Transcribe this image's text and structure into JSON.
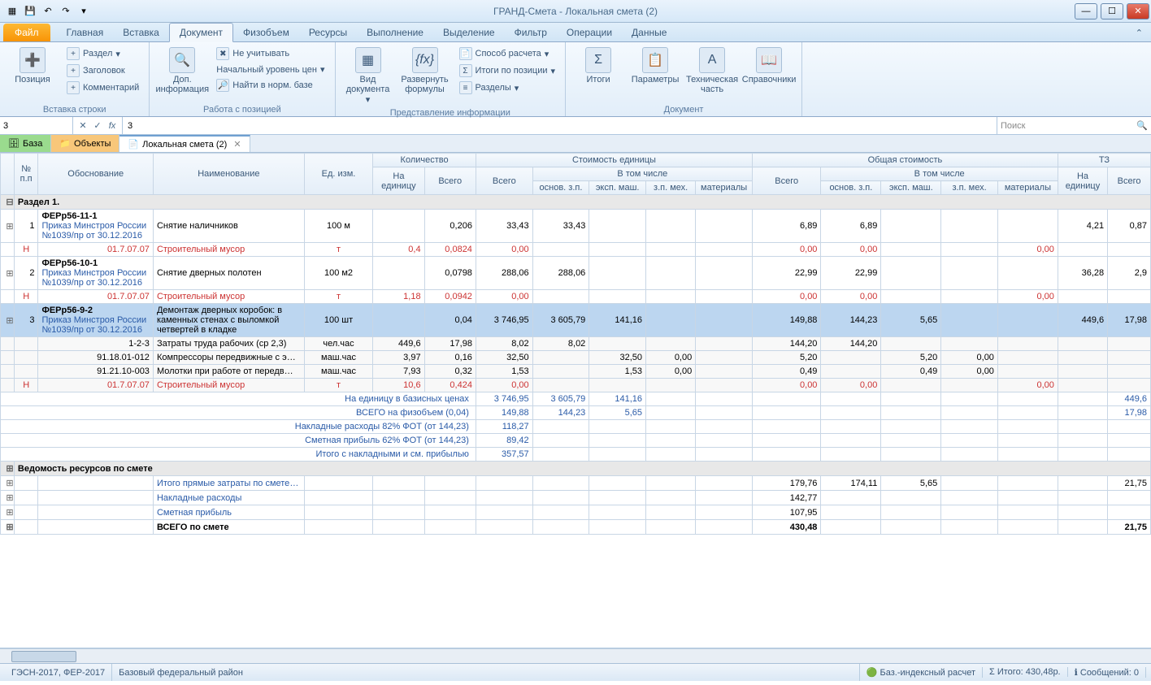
{
  "title": "ГРАНД-Смета - Локальная смета (2)",
  "ribbon_tabs": {
    "file": "Файл",
    "items": [
      "Главная",
      "Вставка",
      "Документ",
      "Физобъем",
      "Ресурсы",
      "Выполнение",
      "Выделение",
      "Фильтр",
      "Операции",
      "Данные"
    ],
    "active": 2
  },
  "ribbon": {
    "g1": {
      "label": "Вставка строки",
      "pos": "Позиция",
      "razdel": "Раздел",
      "zagolovok": "Заголовок",
      "komment": "Комментарий"
    },
    "g2": {
      "label": "Работа с позицией",
      "dopinfo": "Доп.\nинформация",
      "neuchit": "Не учитывать",
      "nachur": "Начальный уровень цен",
      "naiti": "Найти в норм. базе"
    },
    "g3": {
      "label": "Представление информации",
      "viddok": "Вид\nдокумента",
      "razvern": "Развернуть\nформулы",
      "sposob": "Способ расчета",
      "itogipoz": "Итоги по позиции",
      "razdely": "Разделы"
    },
    "g4": {
      "label": "Документ",
      "itogi": "Итоги",
      "param": "Параметры",
      "techchast": "Техническая\nчасть",
      "sprav": "Справочники"
    }
  },
  "formula": {
    "cell": "3",
    "value": "3",
    "search_ph": "Поиск"
  },
  "doctabs": {
    "baza": "База",
    "obj": "Объекты",
    "active": "Локальная смета (2)"
  },
  "headers": {
    "npp": "№\nп.п",
    "obosn": "Обоснование",
    "naim": "Наименование",
    "edizm": "Ед. изм.",
    "kolvo": "Количество",
    "naed": "На\nединицу",
    "vsego": "Всего",
    "stoim_ed": "Стоимость единицы",
    "vtomchisle": "В том числе",
    "osnov": "основ. з.п.",
    "eksp": "эксп. маш.",
    "zpmex": "з.п. мех.",
    "mater": "материалы",
    "obsh": "Общая стоимость",
    "tz": "ТЗ"
  },
  "section1": "Раздел 1.",
  "rows": [
    {
      "n": "1",
      "code": "ФЕРр56-11-1",
      "prikaz": "Приказ Минстроя России №1039/пр от 30.12.2016",
      "naim": "Снятие наличников",
      "ed": "100 м",
      "naed": "",
      "vsego_k": "0,206",
      "vsego": "33,43",
      "osn": "33,43",
      "eksp": "",
      "zpm": "",
      "mat": "",
      "o_vsego": "6,89",
      "o_osn": "6,89",
      "o_eksp": "",
      "o_zpm": "",
      "o_mat": "",
      "tz_ed": "4,21",
      "tz_v": "0,87"
    },
    {
      "h": "Н",
      "code2": "01.7.07.07",
      "naim": "Строительный мусор",
      "ed": "т",
      "naed": "0,4",
      "vsego_k": "0,0824",
      "vsego": "0,00",
      "o_vsego": "0,00",
      "o_osn": "0,00",
      "o_mat": "0,00",
      "red": true
    },
    {
      "n": "2",
      "code": "ФЕРр56-10-1",
      "prikaz": "Приказ Минстроя России №1039/пр от 30.12.2016",
      "naim": "Снятие дверных полотен",
      "ed": "100 м2",
      "naed": "",
      "vsego_k": "0,0798",
      "vsego": "288,06",
      "osn": "288,06",
      "eksp": "",
      "zpm": "",
      "mat": "",
      "o_vsego": "22,99",
      "o_osn": "22,99",
      "o_eksp": "",
      "o_zpm": "",
      "o_mat": "",
      "tz_ed": "36,28",
      "tz_v": "2,9"
    },
    {
      "h": "Н",
      "code2": "01.7.07.07",
      "naim": "Строительный мусор",
      "ed": "т",
      "naed": "1,18",
      "vsego_k": "0,0942",
      "vsego": "0,00",
      "o_vsego": "0,00",
      "o_osn": "0,00",
      "o_mat": "0,00",
      "red": true
    },
    {
      "n": "3",
      "code": "ФЕРр56-9-2",
      "prikaz": "Приказ Минстроя России №1039/пр от 30.12.2016",
      "naim": "Демонтаж дверных коробок: в каменных стенах с выломкой четвертей в кладке",
      "ed": "100 шт",
      "naed": "",
      "vsego_k": "0,04",
      "vsego": "3 746,95",
      "osn": "3 605,79",
      "eksp": "141,16",
      "zpm": "",
      "mat": "",
      "o_vsego": "149,88",
      "o_osn": "144,23",
      "o_eksp": "5,65",
      "o_zpm": "",
      "o_mat": "",
      "tz_ed": "449,6",
      "tz_v": "17,98",
      "sel": true
    },
    {
      "code2": "1-2-3",
      "naim": "Затраты труда рабочих (ср 2,3)",
      "ed": "чел.час",
      "naed": "449,6",
      "vsego_k": "17,98",
      "vsego": "8,02",
      "osn": "8,02",
      "o_vsego": "144,20",
      "o_osn": "144,20",
      "sub": true
    },
    {
      "code2": "91.18.01-012",
      "naim": "Компрессоры передвижные с э…",
      "ed": "маш.час",
      "naed": "3,97",
      "vsego_k": "0,16",
      "vsego": "32,50",
      "eksp": "32,50",
      "zpm": "0,00",
      "o_vsego": "5,20",
      "o_eksp": "5,20",
      "o_zpm": "0,00",
      "sub": true
    },
    {
      "code2": "91.21.10-003",
      "naim": "Молотки при работе от передв…",
      "ed": "маш.час",
      "naed": "7,93",
      "vsego_k": "0,32",
      "vsego": "1,53",
      "eksp": "1,53",
      "zpm": "0,00",
      "o_vsego": "0,49",
      "o_eksp": "0,49",
      "o_zpm": "0,00",
      "sub": true
    },
    {
      "h": "Н",
      "code2": "01.7.07.07",
      "naim": "Строительный мусор",
      "ed": "т",
      "naed": "10,6",
      "vsego_k": "0,424",
      "vsego": "0,00",
      "o_vsego": "0,00",
      "o_osn": "0,00",
      "o_mat": "0,00",
      "red": true,
      "sub": true
    }
  ],
  "summaries": [
    {
      "lbl": "На единицу в базисных ценах",
      "vsego": "3 746,95",
      "osn": "3 605,79",
      "eksp": "141,16",
      "tz": "449,6"
    },
    {
      "lbl": "ВСЕГО на физобъем (0,04)",
      "vsego": "149,88",
      "osn": "144,23",
      "eksp": "5,65",
      "tz": "17,98"
    },
    {
      "lbl": "Накладные расходы 82% ФОТ (от 144,23)",
      "vsego": "118,27"
    },
    {
      "lbl": "Сметная прибыль 62% ФОТ (от 144,23)",
      "vsego": "89,42"
    },
    {
      "lbl": "Итого с накладными и см. прибылью",
      "vsego": "357,57"
    }
  ],
  "vedtitle": "Ведомость ресурсов по смете",
  "ved": [
    {
      "lbl": "Итого прямые затраты по смете в базисных ценах",
      "c1": "179,76",
      "c2": "174,11",
      "c3": "5,65",
      "tz": "21,75"
    },
    {
      "lbl": "Накладные расходы",
      "c1": "142,77"
    },
    {
      "lbl": "Сметная прибыль",
      "c1": "107,95"
    },
    {
      "lbl": "ВСЕГО по смете",
      "c1": "430,48",
      "tz": "21,75",
      "bold": true
    }
  ],
  "status": {
    "gesn": "ГЭСН-2017, ФЕР-2017",
    "region": "Базовый федеральный район",
    "calc": "Баз.-индексный расчет",
    "itogo": "Итого: 430,48р.",
    "msg": "Сообщений: 0"
  }
}
